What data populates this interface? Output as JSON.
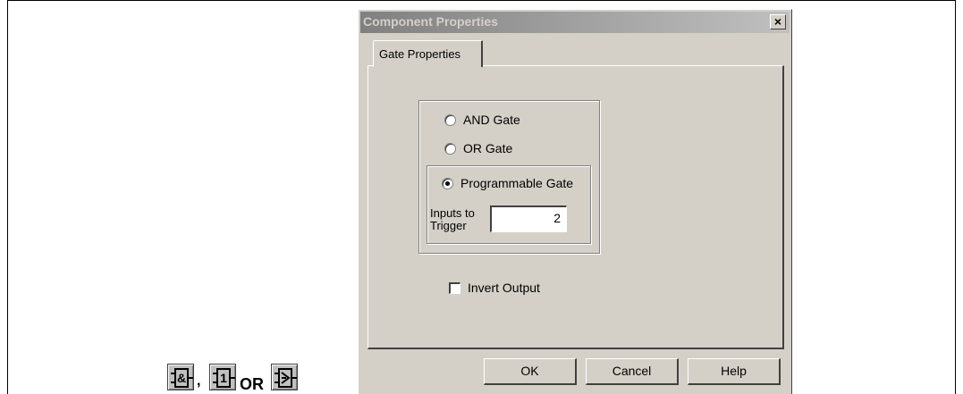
{
  "dialog": {
    "title": "Component Properties",
    "close_glyph": "×",
    "tab_label": "Gate Properties",
    "radios": [
      {
        "label": "AND Gate",
        "checked": false
      },
      {
        "label": "OR Gate",
        "checked": false
      },
      {
        "label": "Programmable Gate",
        "checked": true
      }
    ],
    "inputs_label_line1": "Inputs to",
    "inputs_label_line2": "Trigger",
    "inputs_value": "2",
    "invert_output_label": "Invert Output",
    "invert_output_checked": false,
    "buttons": {
      "ok": "OK",
      "cancel": "Cancel",
      "help": "Help"
    }
  },
  "gate_icons": {
    "and_icon_symbol": "&",
    "or_icon_symbol": "1",
    "separator_comma": ",",
    "separator_or": "OR"
  }
}
